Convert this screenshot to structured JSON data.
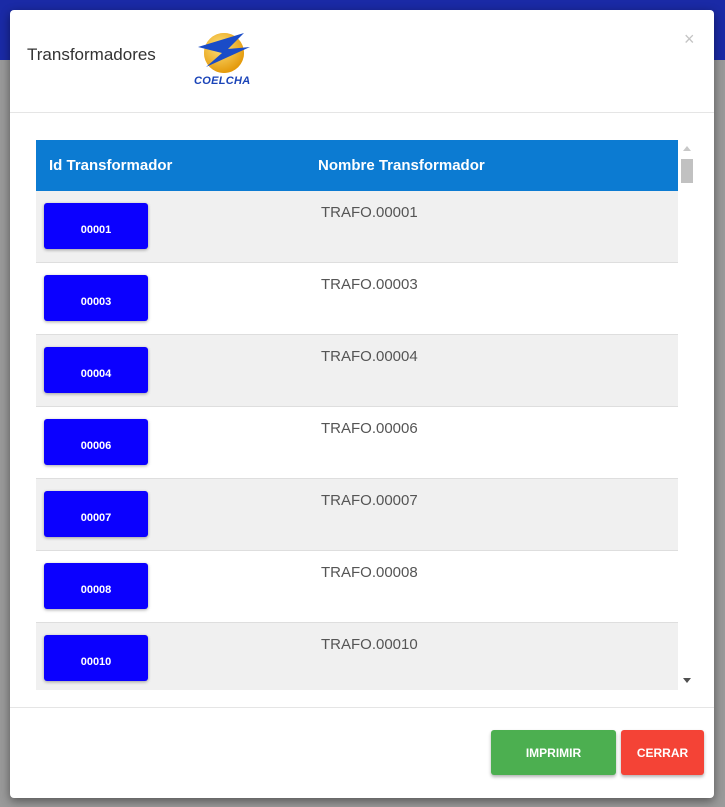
{
  "modal": {
    "title": "Transformadores",
    "logo_text": "COELCHA",
    "close_glyph": "×"
  },
  "table": {
    "columns": [
      "Id Transformador",
      "Nombre Transformador"
    ],
    "rows": [
      {
        "id": "00001",
        "name": "TRAFO.00001"
      },
      {
        "id": "00003",
        "name": "TRAFO.00003"
      },
      {
        "id": "00004",
        "name": "TRAFO.00004"
      },
      {
        "id": "00006",
        "name": "TRAFO.00006"
      },
      {
        "id": "00007",
        "name": "TRAFO.00007"
      },
      {
        "id": "00008",
        "name": "TRAFO.00008"
      },
      {
        "id": "00010",
        "name": "TRAFO.00010"
      }
    ]
  },
  "footer": {
    "print_label": "IMPRIMIR",
    "close_label": "CERRAR"
  },
  "colors": {
    "header_blue": "#0c7bd2",
    "id_button": "#0b00ff",
    "print_green": "#4caf50",
    "close_red": "#f44336"
  }
}
